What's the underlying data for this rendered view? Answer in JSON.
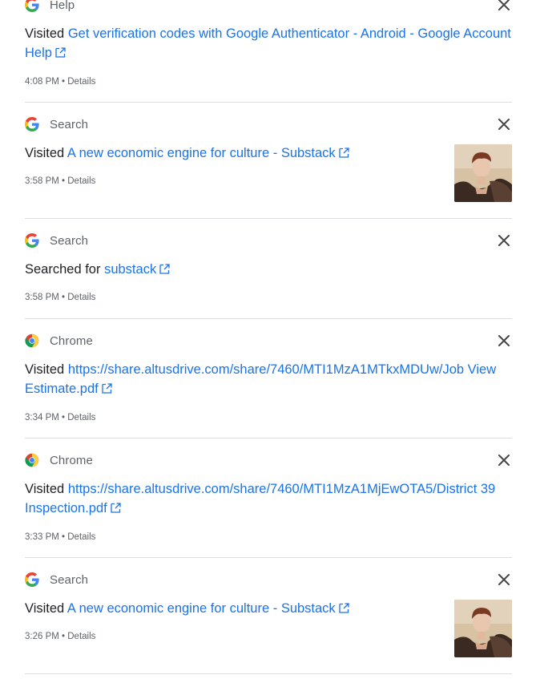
{
  "entries": [
    {
      "product": "Help",
      "product_icon": "google-g-icon",
      "action": "Visited",
      "link_text": "Get verification codes with Google Authenticator - Android - Google Account Help",
      "time": "4:08 PM",
      "details": "Details",
      "has_thumbnail": false
    },
    {
      "product": "Search",
      "product_icon": "google-g-icon",
      "action": "Visited",
      "link_text": "A new economic engine for culture - Substack",
      "time": "3:58 PM",
      "details": "Details",
      "has_thumbnail": true
    },
    {
      "product": "Search",
      "product_icon": "google-g-icon",
      "action": "Searched for",
      "link_text": "substack",
      "time": "3:58 PM",
      "details": "Details",
      "has_thumbnail": false
    },
    {
      "product": "Chrome",
      "product_icon": "chrome-icon",
      "action": "Visited",
      "link_text": "https://share.altusdrive.com/share/7460/MTI1MzA1MTkxMDUw/Job View Estimate.pdf",
      "time": "3:34 PM",
      "details": "Details",
      "has_thumbnail": false
    },
    {
      "product": "Chrome",
      "product_icon": "chrome-icon",
      "action": "Visited",
      "link_text": "https://share.altusdrive.com/share/7460/MTI1MzA1MjEwOTA5/District 39 Inspection.pdf",
      "time": "3:33 PM",
      "details": "Details",
      "has_thumbnail": false
    },
    {
      "product": "Search",
      "product_icon": "google-g-icon",
      "action": "Visited",
      "link_text": "A new economic engine for culture - Substack",
      "time": "3:26 PM",
      "details": "Details",
      "has_thumbnail": true
    }
  ],
  "separator": " • ",
  "icons": {
    "close": "close-icon",
    "external_link": "external-link-icon",
    "thumbnail": "thumbnail-image"
  },
  "colors": {
    "link": "#1a73e8",
    "secondary_text": "#5f6368",
    "primary_text": "#202124",
    "divider": "#dadce0"
  }
}
